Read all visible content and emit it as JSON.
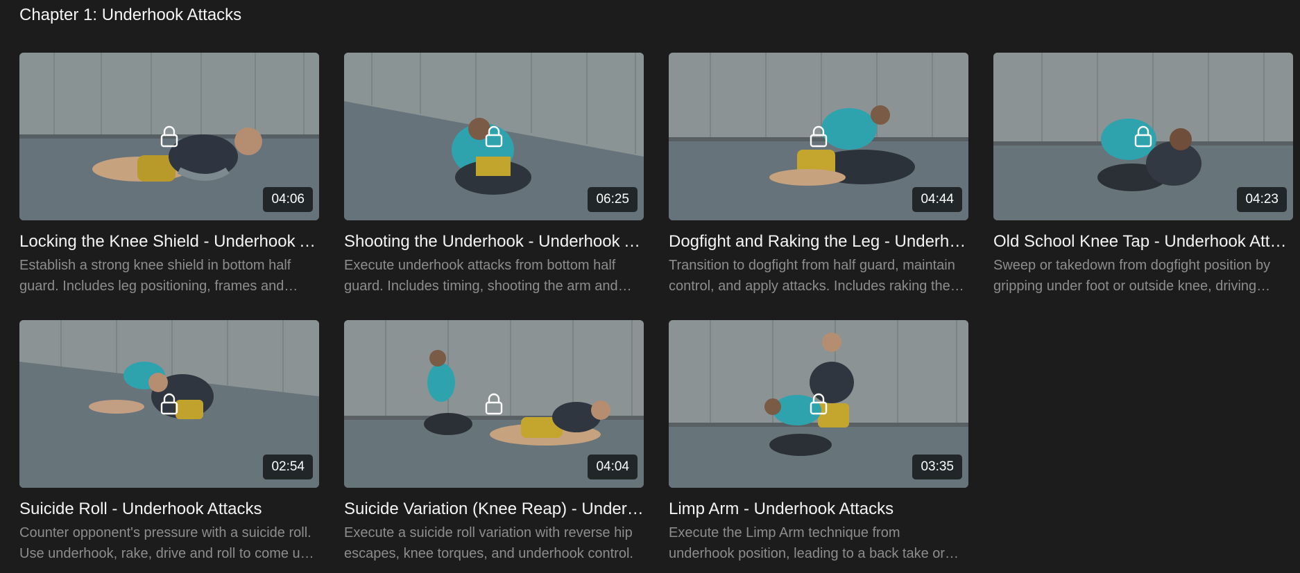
{
  "chapter": {
    "title": "Chapter 1: Underhook Attacks"
  },
  "colors": {
    "background": "#1c1c1c",
    "title_text": "#f4f4f4",
    "description_text": "#8d8d8d",
    "duration_badge": "#181c1e"
  },
  "videos": [
    {
      "title": "Locking the Knee Shield - Underhook Attacks",
      "description": "Establish a strong knee shield in bottom half guard. Includes leg positioning, frames and underhook setups.",
      "duration": "04:06",
      "locked": true,
      "icon": "lock-icon"
    },
    {
      "title": "Shooting the Underhook - Underhook Attacks",
      "description": "Execute underhook attacks from bottom half guard. Includes timing, shooting the arm and head position.",
      "duration": "06:25",
      "locked": true,
      "icon": "lock-icon"
    },
    {
      "title": "Dogfight and Raking the Leg - Underhook Attacks",
      "description": "Transition to dogfight from half guard, maintain control, and apply attacks. Includes raking the leg.",
      "duration": "04:44",
      "locked": true,
      "icon": "lock-icon"
    },
    {
      "title": "Old School Knee Tap - Underhook Attacks",
      "description": "Sweep or takedown from dogfight position by gripping under foot or outside knee, driving forward.",
      "duration": "04:23",
      "locked": true,
      "icon": "lock-icon"
    },
    {
      "title": "Suicide Roll - Underhook Attacks",
      "description": "Counter opponent's pressure with a suicide roll. Use underhook, rake, drive and roll to come up on top.",
      "duration": "02:54",
      "locked": true,
      "icon": "lock-icon"
    },
    {
      "title": "Suicide Variation (Knee Reap) - Underhook Attacks",
      "description": "Execute a suicide roll variation with reverse hip escapes, knee torques, and underhook control.",
      "duration": "04:04",
      "locked": true,
      "icon": "lock-icon"
    },
    {
      "title": "Limp Arm - Underhook Attacks",
      "description": "Execute the Limp Arm technique from underhook position, leading to a back take or sweep.",
      "duration": "03:35",
      "locked": true,
      "icon": "lock-icon"
    }
  ]
}
